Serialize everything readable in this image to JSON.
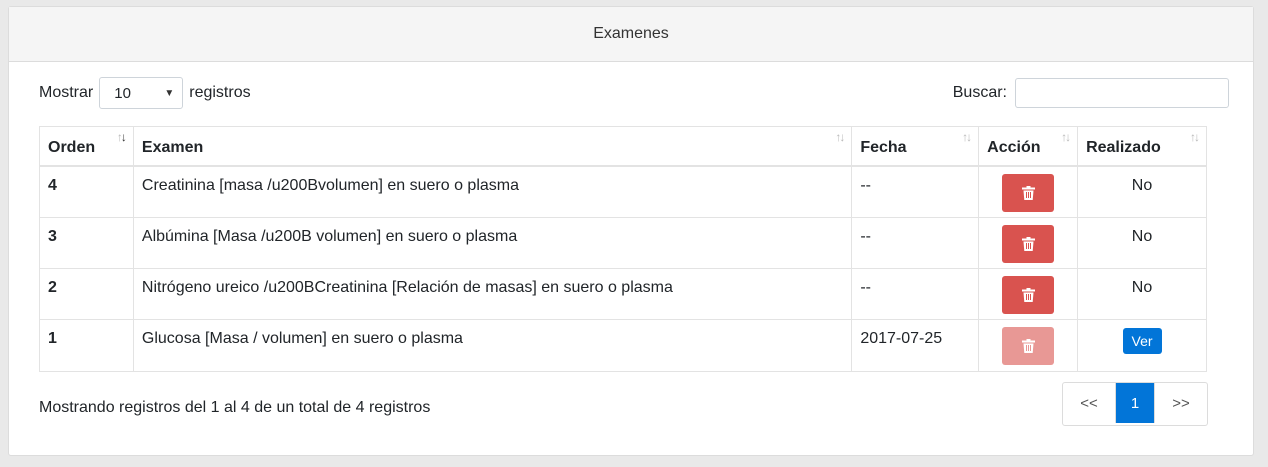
{
  "panel": {
    "title": "Examenes"
  },
  "length": {
    "prefix": "Mostrar",
    "value": "10",
    "suffix": "registros"
  },
  "search": {
    "label": "Buscar:",
    "value": "",
    "placeholder": ""
  },
  "table": {
    "headers": [
      "Orden",
      "Examen",
      "Fecha",
      "Acción",
      "Realizado"
    ],
    "rows": [
      {
        "orden": "4",
        "examen": "Creatinina [masa /u200Bvolumen] en suero o plasma",
        "fecha": "--",
        "realizado": "No"
      },
      {
        "orden": "3",
        "examen": "Albúmina [Masa /u200B volumen] en suero o plasma",
        "fecha": "--",
        "realizado": "No"
      },
      {
        "orden": "2",
        "examen": "Nitrógeno ureico /u200BCreatinina [Relación de masas] en suero o plasma",
        "fecha": "--",
        "realizado": "No"
      },
      {
        "orden": "1",
        "examen": "Glucosa [Masa / volumen] en suero o plasma",
        "fecha": "2017-07-25",
        "realizado": "Ver"
      }
    ]
  },
  "info": "Mostrando registros del 1 al 4 de un total de 4 registros",
  "pagination": {
    "prev": "<<",
    "current": "1",
    "next": ">>"
  },
  "icons": {
    "delete": "trash-icon"
  },
  "colors": {
    "danger": "#d9534f",
    "primary": "#0275d8"
  }
}
